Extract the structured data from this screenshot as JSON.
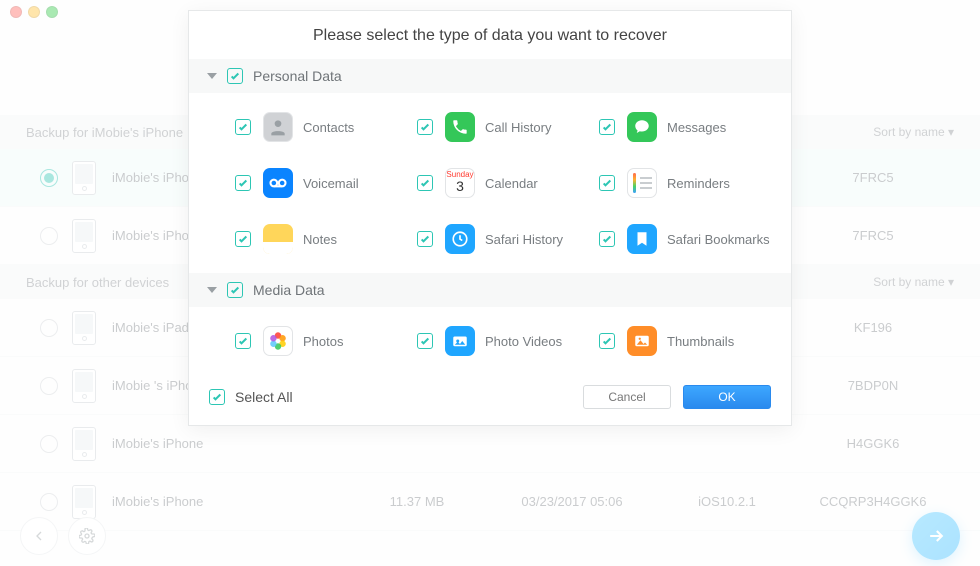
{
  "window": {
    "traffic": [
      "close",
      "min",
      "max"
    ]
  },
  "modal": {
    "title": "Please select the type of data you want to recover",
    "select_all": "Select All",
    "cancel": "Cancel",
    "ok": "OK",
    "categories": [
      {
        "label": "Personal Data",
        "items": [
          {
            "label": "Contacts",
            "icon": "contacts",
            "color": "#d0d2d5"
          },
          {
            "label": "Call History",
            "icon": "call-history",
            "color": "#34c759"
          },
          {
            "label": "Messages",
            "icon": "messages",
            "color": "#34c759"
          },
          {
            "label": "Voicemail",
            "icon": "voicemail",
            "color": "#0a84ff"
          },
          {
            "label": "Calendar",
            "icon": "calendar",
            "color": "#ffffff"
          },
          {
            "label": "Reminders",
            "icon": "reminders",
            "color": "#ffffff"
          },
          {
            "label": "Notes",
            "icon": "notes",
            "color": "#ffd65a"
          },
          {
            "label": "Safari History",
            "icon": "safari-history",
            "color": "#1fa6ff"
          },
          {
            "label": "Safari Bookmarks",
            "icon": "safari-bookmarks",
            "color": "#1fa6ff"
          }
        ]
      },
      {
        "label": "Media Data",
        "items": [
          {
            "label": "Photos",
            "icon": "photos",
            "color": "#ffffff"
          },
          {
            "label": "Photo Videos",
            "icon": "photo-videos",
            "color": "#1fa6ff"
          },
          {
            "label": "Thumbnails",
            "icon": "thumbnails",
            "color": "#ff8d28"
          }
        ]
      }
    ]
  },
  "list": {
    "sort_label": "Sort by name ▾",
    "sections": [
      {
        "header": "Backup for iMobie's iPhone",
        "rows": [
          {
            "name": "iMobie's iPhone",
            "size": "",
            "date": "",
            "ios": "",
            "serial": "7FRC5",
            "selected": true
          },
          {
            "name": "iMobie's iPhone",
            "size": "",
            "date": "",
            "ios": "",
            "serial": "7FRC5",
            "selected": false
          }
        ]
      },
      {
        "header": "Backup for other devices",
        "rows": [
          {
            "name": "iMobie's iPad",
            "size": "",
            "date": "",
            "ios": "",
            "serial": "KF196",
            "selected": false
          },
          {
            "name": "iMobie 's iPhone",
            "size": "",
            "date": "",
            "ios": "",
            "serial": "7BDP0N",
            "selected": false
          },
          {
            "name": "iMobie's iPhone",
            "size": "",
            "date": "",
            "ios": "",
            "serial": "H4GGK6",
            "selected": false
          },
          {
            "name": "iMobie's iPhone",
            "size": "11.37 MB",
            "date": "03/23/2017 05:06",
            "ios": "iOS10.2.1",
            "serial": "CCQRP3H4GGK6",
            "selected": false
          }
        ]
      }
    ]
  }
}
